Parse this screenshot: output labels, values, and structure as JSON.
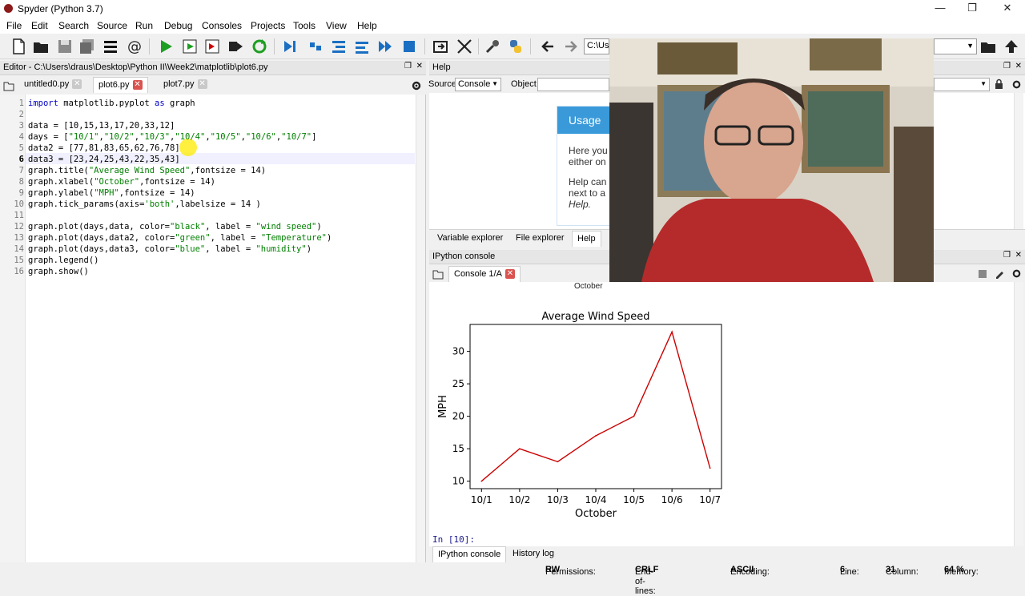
{
  "window": {
    "title": "Spyder (Python 3.7)"
  },
  "menu": [
    "File",
    "Edit",
    "Search",
    "Source",
    "Run",
    "Debug",
    "Consoles",
    "Projects",
    "Tools",
    "View",
    "Help"
  ],
  "toolbar": {
    "path_value": "C:\\Use"
  },
  "editor": {
    "header": "Editor - C:\\Users\\draus\\Desktop\\Python II\\Week2\\matplotlib\\plot6.py",
    "tabs": [
      "untitled0.py",
      "plot6.py",
      "plot7.py"
    ],
    "lines": [
      "import matplotlib.pyplot as graph",
      "",
      "data = [10,15,13,17,20,33,12]",
      "days = [\"10/1\",\"10/2\",\"10/3\",\"10/4\",\"10/5\",\"10/6\",\"10/7\"]",
      "data2 = [77,81,83,65,62,76,78]",
      "data3 = [23,24,25,43,22,35,43]",
      "graph.title(\"Average Wind Speed\",fontsize = 14)",
      "graph.xlabel(\"October\",fontsize = 14)",
      "graph.ylabel(\"MPH\",fontsize = 14)",
      "graph.tick_params(axis='both',labelsize = 14 )",
      "",
      "graph.plot(days,data, color=\"black\", label = \"wind speed\")",
      "graph.plot(days,data2, color=\"green\", label = \"Temperature\")",
      "graph.plot(days,data3, color=\"blue\", label = \"humidity\")",
      "graph.legend()",
      "graph.show()"
    ],
    "line_numbers": [
      "1",
      "2",
      "3",
      "4",
      "5",
      "6",
      "7",
      "8",
      "9",
      "10",
      "11",
      "12",
      "13",
      "14",
      "15",
      "16"
    ]
  },
  "help": {
    "header": "Help",
    "source_label": "Source",
    "source_value": "Console",
    "object_label": "Object",
    "usage_title": "Usage",
    "usage_text_1": "Here you",
    "usage_text_2": "either on",
    "usage_text_3": "Help can",
    "usage_text_4": "next to a",
    "usage_text_5": "Help.",
    "tabs": [
      "Variable explorer",
      "File explorer",
      "Help"
    ]
  },
  "console": {
    "header": "IPython console",
    "tab": "Console 1/A",
    "prev_label": "October",
    "prompt": "In [10]:",
    "bottom_tabs": [
      "IPython console",
      "History log"
    ]
  },
  "chart_data": {
    "type": "line",
    "title": "Average Wind Speed",
    "xlabel": "October",
    "ylabel": "MPH",
    "categories": [
      "10/1",
      "10/2",
      "10/3",
      "10/4",
      "10/5",
      "10/6",
      "10/7"
    ],
    "series": [
      {
        "values": [
          10,
          15,
          13,
          17,
          20,
          33,
          12
        ],
        "color": "#cc0000"
      }
    ],
    "yticks": [
      10,
      15,
      20,
      25,
      30
    ],
    "ylim": [
      8.85,
      34.15
    ],
    "grid": false
  },
  "status": {
    "permissions_label": "Permissions:",
    "permissions_value": "RW",
    "eol_label": "End-of-lines:",
    "eol_value": "CRLF",
    "encoding_label": "Encoding:",
    "encoding_value": "ASCII",
    "line_label": "Line:",
    "line_value": "6",
    "column_label": "Column:",
    "column_value": "31",
    "memory_label": "Memory:",
    "memory_value": "64 %"
  },
  "colors": {
    "accent": "#3a9ad9",
    "close": "#d9534f",
    "plot_line": "#cc0000"
  }
}
